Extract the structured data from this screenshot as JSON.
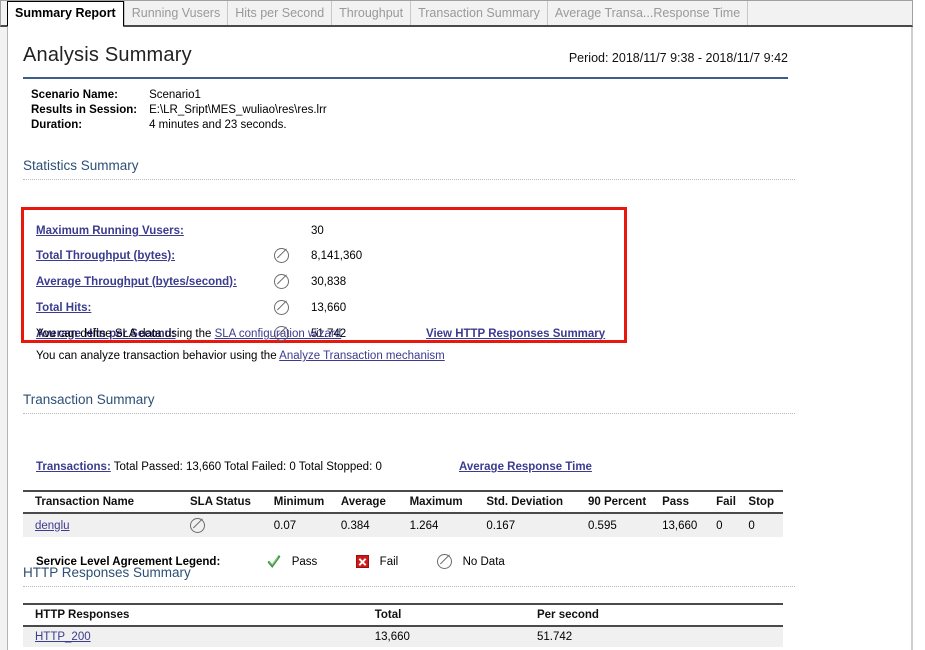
{
  "tabs": [
    {
      "label": "Summary Report",
      "active": true
    },
    {
      "label": "Running Vusers",
      "active": false
    },
    {
      "label": "Hits per Second",
      "active": false
    },
    {
      "label": "Throughput",
      "active": false
    },
    {
      "label": "Transaction Summary",
      "active": false
    },
    {
      "label": "Average Transa...Response Time",
      "active": false
    }
  ],
  "header": {
    "title": "Analysis Summary",
    "period": "Period: 2018/11/7 9:38 - 2018/11/7 9:42"
  },
  "scenario": {
    "rows": [
      {
        "key": "Scenario Name:",
        "value": "Scenario1"
      },
      {
        "key": "Results in Session:",
        "value": "E:\\LR_Sript\\MES_wuliao\\res\\res.lrr"
      },
      {
        "key": "Duration:",
        "value": "4 minutes and 23 seconds."
      }
    ]
  },
  "statistics": {
    "heading": "Statistics Summary",
    "rows": [
      {
        "label": "Maximum Running Vusers:",
        "icon": "",
        "value": "30",
        "link": ""
      },
      {
        "label": "Total Throughput (bytes):",
        "icon": "no-data",
        "value": "8,141,360",
        "link": ""
      },
      {
        "label": "Average Throughput (bytes/second):",
        "icon": "no-data",
        "value": "30,838",
        "link": ""
      },
      {
        "label": "Total Hits:",
        "icon": "no-data",
        "value": "13,660",
        "link": ""
      },
      {
        "label": "Average Hits per Second:",
        "icon": "no-data",
        "value": "51.742",
        "link": "View HTTP Responses Summary"
      }
    ],
    "highlight_color": "#e8180c"
  },
  "hints": [
    {
      "prefix": "You can define SLA data using the ",
      "link": "SLA configuration wizard"
    },
    {
      "prefix": "You can analyze transaction behavior using the ",
      "link": "Analyze Transaction mechanism"
    }
  ],
  "transaction_summary": {
    "heading": "Transaction Summary",
    "transactions_link": "Transactions:",
    "transactions_text": " Total Passed: 13,660 Total Failed: 0 Total Stopped: 0",
    "avg_response_link": "Average Response Time",
    "columns": [
      "Transaction Name",
      "SLA Status",
      "Minimum",
      "Average",
      "Maximum",
      "Std. Deviation",
      "90 Percent",
      "Pass",
      "Fail",
      "Stop"
    ],
    "rows": [
      {
        "name": "denglu",
        "sla_status": "no-data",
        "minimum": "0.07",
        "average": "0.384",
        "maximum": "1.264",
        "std_deviation": "0.167",
        "percent90": "0.595",
        "pass": "13,660",
        "fail": "0",
        "stop": "0"
      }
    ]
  },
  "sla_legend": {
    "title": "Service Level Agreement Legend:",
    "items": [
      {
        "icon": "pass-check-icon",
        "label": "Pass"
      },
      {
        "icon": "fail-x-icon",
        "label": "Fail"
      },
      {
        "icon": "no-data-icon",
        "label": "No Data"
      }
    ]
  },
  "http_responses": {
    "heading": "HTTP Responses Summary",
    "columns": [
      "HTTP Responses",
      "Total",
      "Per second"
    ],
    "rows": [
      {
        "response": "HTTP_200",
        "total": "13,660",
        "per_second": "51.742"
      }
    ]
  }
}
